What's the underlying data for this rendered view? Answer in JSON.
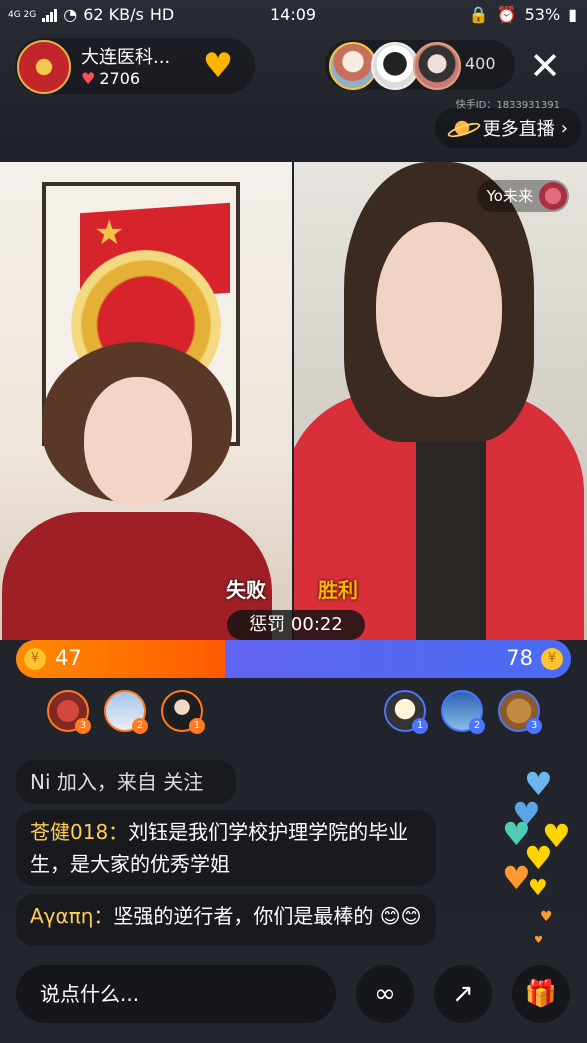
{
  "status": {
    "left": "4G 2G",
    "speed": "62 KB/s",
    "hd": "HD",
    "time": "14:09",
    "battery": "53%"
  },
  "host": {
    "name": "大连医科...",
    "likes": "2706"
  },
  "viewers": {
    "count": "400"
  },
  "kuaishou_id": "快手ID：1833931391",
  "more_live_label": "更多直播",
  "guest_name": "Yo未来",
  "pk": {
    "lose_label": "失败",
    "win_label": "胜利",
    "punish_label": "惩罚 00:22",
    "left_score": "47",
    "right_score": "78",
    "left_fill": 0.376
  },
  "supporters": {
    "left_ranks": [
      "3",
      "2",
      "1"
    ],
    "right_ranks": [
      "1",
      "2",
      "3"
    ]
  },
  "comments": {
    "join": "Ni 加入，来自 关注",
    "c1_user": "苍健018：",
    "c1_text": "刘钰是我们学校护理学院的毕业生，是大家的优秀学姐",
    "c2_user": "Αγαπη：",
    "c2_text": "坚强的逆行者，你们是最棒的 😊😊"
  },
  "input_placeholder": "说点什么...",
  "colors": {
    "accent": "#ffb400",
    "pk_left": "#ff6a00",
    "pk_right": "#5b64ef"
  }
}
